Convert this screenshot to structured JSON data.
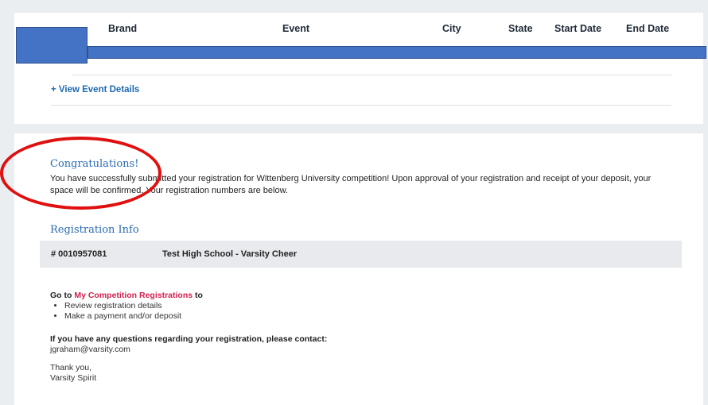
{
  "table": {
    "headers": {
      "brand": "Brand",
      "event": "Event",
      "city": "City",
      "state": "State",
      "start_date": "Start Date",
      "end_date": "End Date"
    }
  },
  "view_event_details": "+ View Event Details",
  "confirmation": {
    "title": "Congratulations!",
    "message": "You have successfully submitted your registration for Wittenberg University competition! Upon approval of your registration and receipt of your deposit, your space will be confirmed. Your registration numbers are below."
  },
  "registration_info": {
    "title": "Registration Info",
    "number": "# 0010957081",
    "team": "Test High School - Varsity Cheer"
  },
  "next_steps": {
    "prefix": "Go to ",
    "link": "My Competition Registrations",
    "suffix": " to",
    "items": [
      "Review registration details",
      "Make a payment and/or deposit"
    ]
  },
  "contact": {
    "question": "If you have any questions regarding your registration, please contact:",
    "email": "jgraham@varsity.com"
  },
  "signoff": {
    "line1": "Thank you,",
    "line2": "Varsity Spirit"
  },
  "colors": {
    "link_blue": "#1e68b3",
    "link_red": "#d1214f",
    "title_blue": "#2a6bb0",
    "redaction": "#4472c4",
    "annotation_circle": "#e01010"
  }
}
